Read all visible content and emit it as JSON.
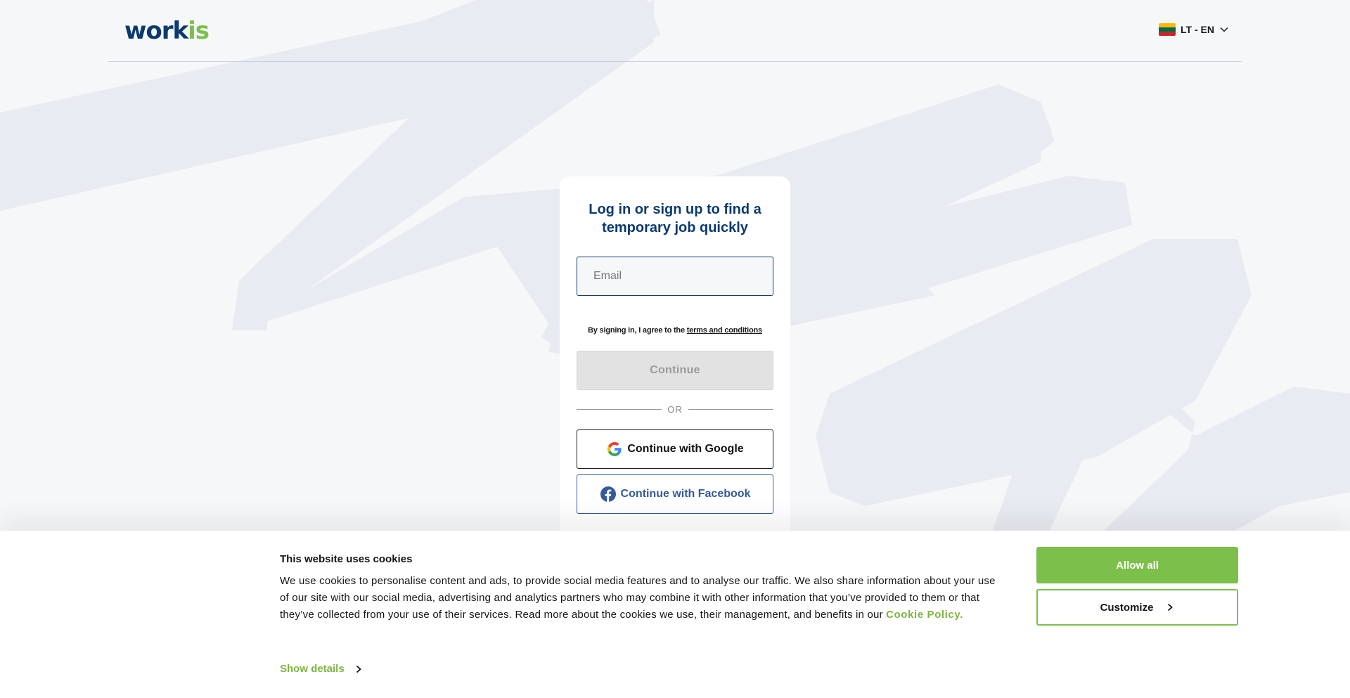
{
  "header": {
    "logo_part1": "work",
    "logo_part2": "is",
    "language_label": "LT - EN",
    "flag_colors": [
      "#fdb913",
      "#006a44",
      "#c1272d"
    ]
  },
  "login": {
    "title": "Log in or sign up to find a temporary job quickly",
    "email_placeholder": "Email",
    "email_value": "",
    "terms_text": "By signing in, I agree to the ",
    "terms_link": "terms and conditions",
    "continue_label": "Continue",
    "or_label": "OR",
    "google_label": "Continue with Google",
    "facebook_label": "Continue with Facebook"
  },
  "cookie_banner": {
    "title": "This website uses cookies",
    "body": "We use cookies to personalise content and ads, to provide social media features and to analyse our traffic. We also share information about your use of our site with our social media, advertising and analytics partners who may combine it with other information that you’ve provided to them or that they’ve collected from your use of their services. Read more about the cookies we use, their management, and benefits in our ",
    "policy_link": "Cookie Policy.",
    "show_details": "Show details",
    "allow_all": "Allow all",
    "customize": "Customize"
  },
  "colors": {
    "brand_navy": "#0b3a6e",
    "brand_green": "#7cbf4b",
    "facebook_blue": "#34599c"
  }
}
